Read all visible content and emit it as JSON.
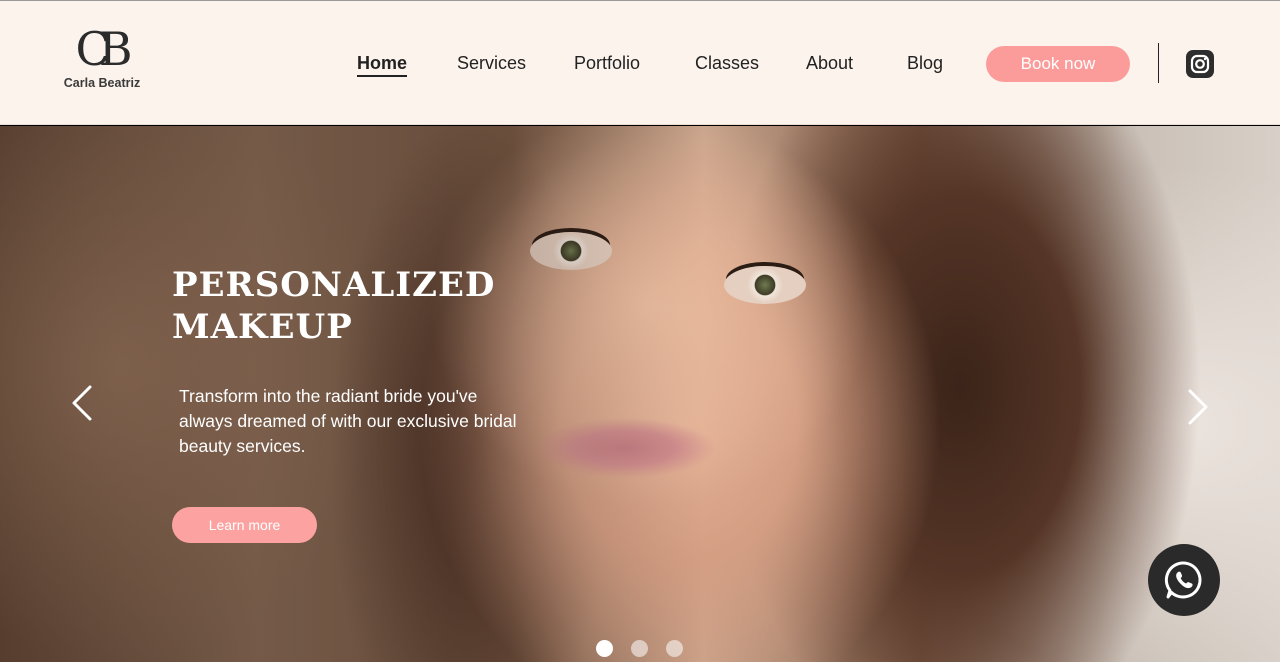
{
  "brand": {
    "monogram": "CB",
    "name": "Carla Beatriz"
  },
  "nav": {
    "items": [
      {
        "label": "Home",
        "active": true
      },
      {
        "label": "Services",
        "active": false
      },
      {
        "label": "Portfolio",
        "active": false
      },
      {
        "label": "Classes",
        "active": false
      },
      {
        "label": "About",
        "active": false
      },
      {
        "label": "Blog",
        "active": false
      }
    ],
    "book_label": "Book now"
  },
  "icons": {
    "social": "instagram-icon",
    "prev": "chevron-left-icon",
    "next": "chevron-right-icon",
    "chat": "whatsapp-icon"
  },
  "hero": {
    "title_line1": "Personalized",
    "title_line2": "Makeup",
    "subtitle": "Transform into the radiant bride you've always dreamed of with our exclusive bridal beauty services.",
    "cta_label": "Learn more"
  },
  "carousel": {
    "slide_count": 3,
    "active_index": 0
  },
  "colors": {
    "header_bg": "#fcf3ec",
    "accent_pink": "#fc9c9a",
    "dark": "#2a2a2a"
  }
}
